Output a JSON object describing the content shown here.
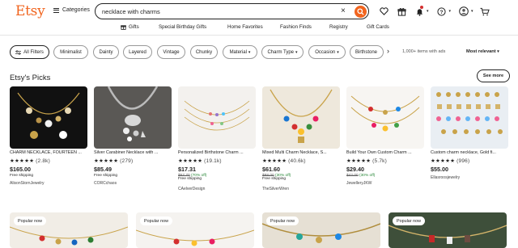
{
  "logo": "Etsy",
  "header": {
    "categories": "Categories",
    "search_value": "necklace with charms"
  },
  "colors": {
    "brand": "#f1641e",
    "sale": "#258635",
    "text": "#222222"
  },
  "nav": [
    "Gifts",
    "Special Birthday Gifts",
    "Home Favorites",
    "Fashion Finds",
    "Registry",
    "Gift Cards"
  ],
  "filters": {
    "all": "All Filters",
    "chips": [
      "Minimalist",
      "Dainty",
      "Layered",
      "Vintage",
      "Chunky",
      "Material",
      "Charm Type",
      "Occasion",
      "Birthstone"
    ],
    "results": "1,000+ items with ads",
    "sort": "Most relevant"
  },
  "section": {
    "title": "Etsy's Picks",
    "see_more": "See more"
  },
  "products": [
    {
      "title": "CHARM NECKLACE, FOURTEEN ...",
      "stars": "★★★★★",
      "reviews": "(2.8k)",
      "price": "$165.00",
      "shipping": "Free shipping",
      "shop": "AlisonStornJewelry"
    },
    {
      "title": "Silver Carabiner Necklace with ...",
      "stars": "★★★★★",
      "reviews": "(279)",
      "price": "$85.49",
      "shipping": "Free shipping",
      "shop": "CORCchaos"
    },
    {
      "title": "Personalized Birthstone Charm ...",
      "stars": "★★★★★",
      "reviews": "(19.1k)",
      "price": "$17.31",
      "old": "$57.70",
      "off": "(70% off)",
      "shipping": "Free shipping",
      "shop": "CAelverDesign"
    },
    {
      "title": "Mixed Multi Charm Necklace, S...",
      "stars": "★★★★★",
      "reviews": "(40.6k)",
      "price": "$61.60",
      "old": "$88.00",
      "off": "(30% off)",
      "shipping": "Free shipping",
      "shop": "TheSilverWren"
    },
    {
      "title": "Build Your Own Custom Charm ...",
      "stars": "★★★★★",
      "reviews": "(5.7k)",
      "price": "$29.40",
      "old": "$42.00",
      "off": "(30% off)",
      "shipping": "",
      "shop": "JewelleryJKW"
    },
    {
      "title": "Custom charm necklace, Gold fi...",
      "stars": "★★★★★",
      "reviews": "(996)",
      "price": "$55.00",
      "shipping": "",
      "shop": "Ellasroosjewelry"
    }
  ],
  "popular_label": "Popular now"
}
